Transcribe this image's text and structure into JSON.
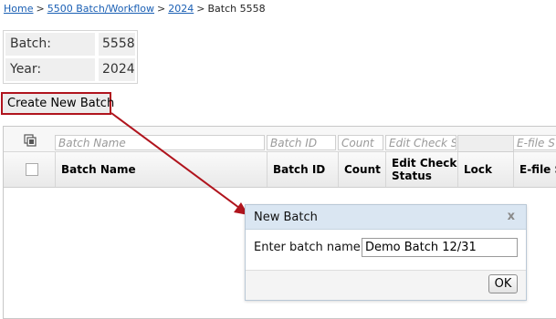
{
  "breadcrumb": {
    "items": [
      {
        "label": "Home",
        "link": true
      },
      {
        "label": "5500 Batch/Workflow",
        "link": true
      },
      {
        "label": "2024",
        "link": true
      },
      {
        "label": "Batch 5558",
        "link": false
      }
    ],
    "separator": ">"
  },
  "info": {
    "batch_label": "Batch:",
    "batch_value": "5558",
    "year_label": "Year:",
    "year_value": "2024"
  },
  "create_button": {
    "label": "Create New Batch"
  },
  "grid": {
    "filters": {
      "batch_name": "Batch Name",
      "batch_id": "Batch ID",
      "count": "Count",
      "edit_check": "Edit Check S",
      "efile": "E-file S"
    },
    "columns": {
      "batch_name": "Batch Name",
      "batch_id": "Batch ID",
      "count": "Count",
      "edit_check_line1": "Edit Check",
      "edit_check_line2": "Status",
      "lock": "Lock",
      "efile": "E-file S"
    },
    "rows": []
  },
  "dialog": {
    "title": "New Batch",
    "close_symbol": "x",
    "field_label": "Enter batch name:",
    "field_value": "Demo Batch 12/31",
    "ok_label": "OK"
  },
  "colors": {
    "highlight_red": "#b0141d",
    "link_blue": "#1a5fb4",
    "dialog_header": "#dae6f2"
  }
}
